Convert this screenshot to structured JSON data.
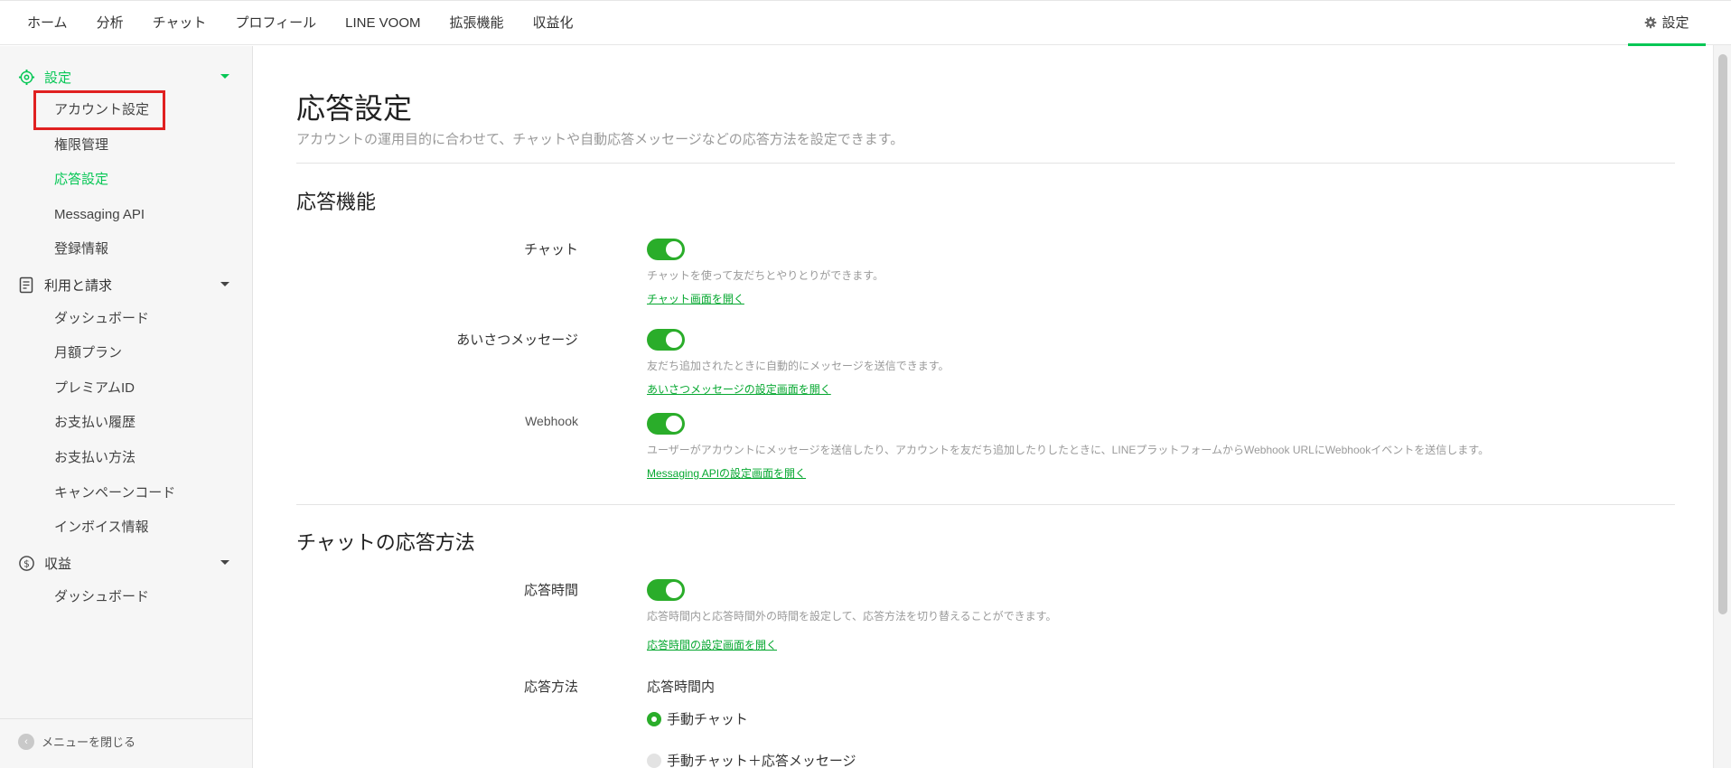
{
  "topnav": {
    "tabs": [
      "ホーム",
      "分析",
      "チャット",
      "プロフィール",
      "LINE VOOM",
      "拡張機能",
      "収益化"
    ],
    "settings_label": "設定"
  },
  "sidebar": {
    "groups": [
      {
        "label": "設定",
        "icon": "gear-icon",
        "items": [
          "アカウント設定",
          "権限管理",
          "応答設定",
          "Messaging API",
          "登録情報"
        ]
      },
      {
        "label": "利用と請求",
        "icon": "billing-icon",
        "items": [
          "ダッシュボード",
          "月額プラン",
          "プレミアムID",
          "お支払い履歴",
          "お支払い方法",
          "キャンペーンコード",
          "インボイス情報"
        ]
      },
      {
        "label": "収益",
        "icon": "dollar-icon",
        "items": [
          "ダッシュボード"
        ]
      }
    ],
    "active_item": "応答設定",
    "close_label": "メニューを閉じる"
  },
  "main": {
    "title": "応答設定",
    "description": "アカウントの運用目的に合わせて、チャットや自動応答メッセージなどの応答方法を設定できます。",
    "section1": {
      "title": "応答機能",
      "rows": [
        {
          "label": "チャット",
          "enabled": true,
          "help": "チャットを使って友だちとやりとりができます。",
          "link": "チャット画面を開く"
        },
        {
          "label": "あいさつメッセージ",
          "enabled": true,
          "help": "友だち追加されたときに自動的にメッセージを送信できます。",
          "link": "あいさつメッセージの設定画面を開く"
        },
        {
          "label": "Webhook",
          "enabled": true,
          "help": "ユーザーがアカウントにメッセージを送信したり、アカウントを友だち追加したりしたときに、LINEプラットフォームからWebhook URLにWebhookイベントを送信します。",
          "link": "Messaging APIの設定画面を開く"
        }
      ]
    },
    "section2": {
      "title": "チャットの応答方法",
      "response_time": {
        "label": "応答時間",
        "enabled": true,
        "help": "応答時間内と応答時間外の時間を設定して、応答方法を切り替えることができます。",
        "link": "応答時間の設定画面を開く"
      },
      "response_method": {
        "label": "応答方法",
        "sub_label": "応答時間内",
        "options": [
          "手動チャット",
          "手動チャット＋応答メッセージ"
        ],
        "selected": "手動チャット"
      }
    }
  }
}
